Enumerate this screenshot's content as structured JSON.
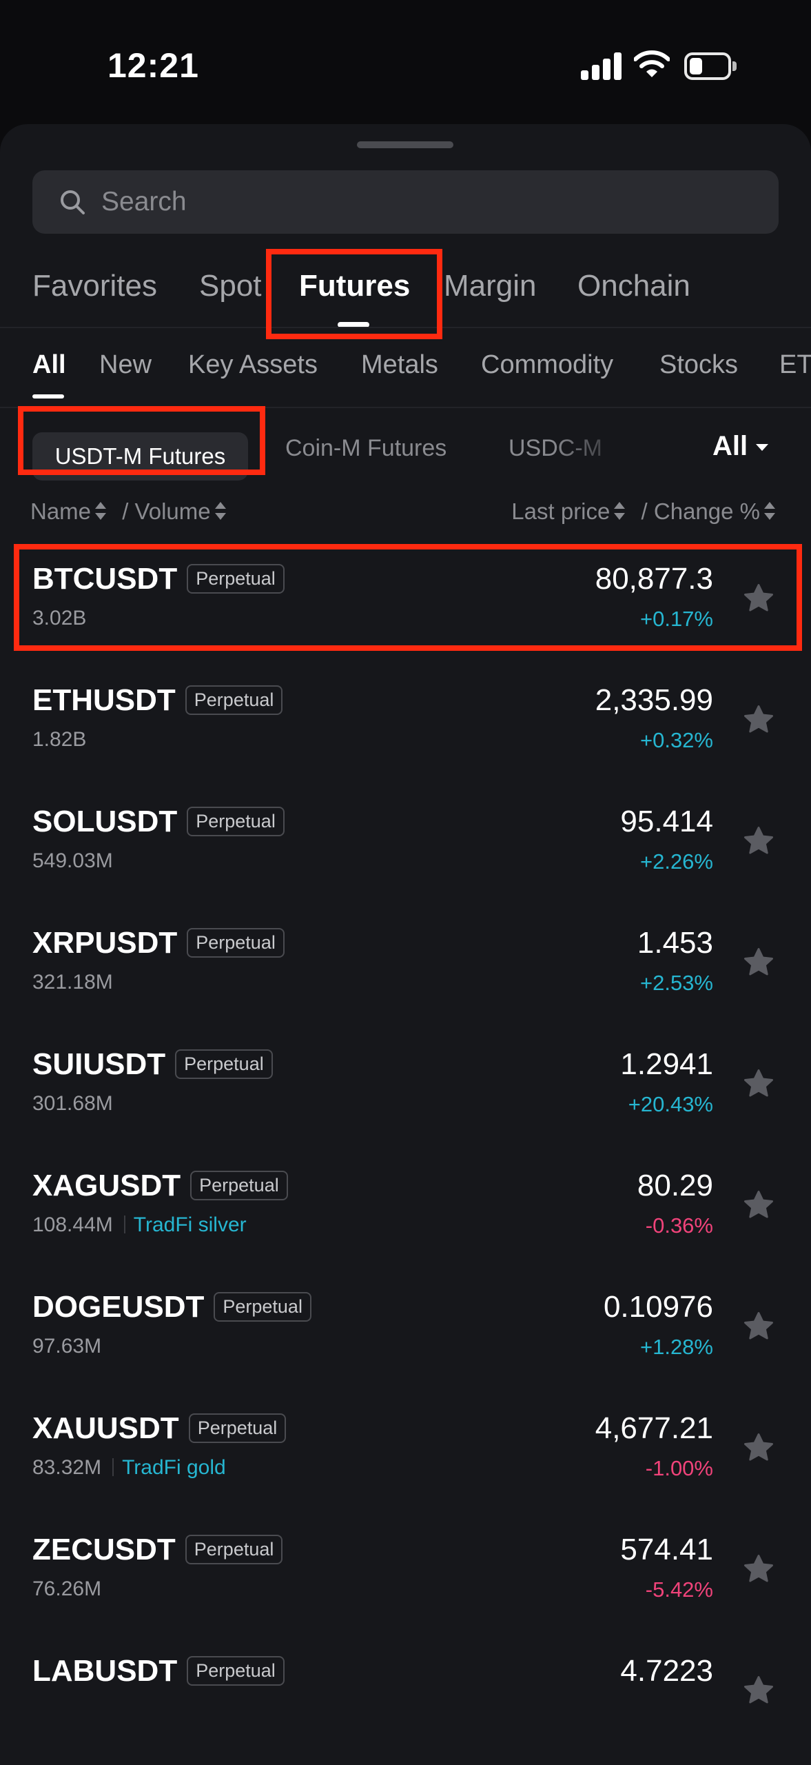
{
  "status_bar": {
    "time": "12:21"
  },
  "search": {
    "placeholder": "Search"
  },
  "main_tabs": [
    "Favorites",
    "Spot",
    "Futures",
    "Margin",
    "Onchain"
  ],
  "category_tabs": [
    "All",
    "New",
    "Key Assets",
    "Metals",
    "Commodity",
    "Stocks",
    "ET"
  ],
  "sub_tabs": [
    "USDT-M Futures",
    "Coin-M Futures",
    "USDC-M"
  ],
  "filter": {
    "label": "All"
  },
  "columns": {
    "name": "Name",
    "volume": "/ Volume",
    "last_price": "Last price",
    "change": "/ Change %"
  },
  "colors": {
    "up": "#26b6d1",
    "down": "#f0437a",
    "highlight": "#ff2a10"
  },
  "rows": [
    {
      "symbol": "BTCUSDT",
      "badge": "Perpetual",
      "volume": "3.02B",
      "tag": "",
      "price": "80,877.3",
      "change": "+0.17%",
      "direction": "up"
    },
    {
      "symbol": "ETHUSDT",
      "badge": "Perpetual",
      "volume": "1.82B",
      "tag": "",
      "price": "2,335.99",
      "change": "+0.32%",
      "direction": "up"
    },
    {
      "symbol": "SOLUSDT",
      "badge": "Perpetual",
      "volume": "549.03M",
      "tag": "",
      "price": "95.414",
      "change": "+2.26%",
      "direction": "up"
    },
    {
      "symbol": "XRPUSDT",
      "badge": "Perpetual",
      "volume": "321.18M",
      "tag": "",
      "price": "1.453",
      "change": "+2.53%",
      "direction": "up"
    },
    {
      "symbol": "SUIUSDT",
      "badge": "Perpetual",
      "volume": "301.68M",
      "tag": "",
      "price": "1.2941",
      "change": "+20.43%",
      "direction": "up"
    },
    {
      "symbol": "XAGUSDT",
      "badge": "Perpetual",
      "volume": "108.44M",
      "tag": "TradFi silver",
      "price": "80.29",
      "change": "-0.36%",
      "direction": "down"
    },
    {
      "symbol": "DOGEUSDT",
      "badge": "Perpetual",
      "volume": "97.63M",
      "tag": "",
      "price": "0.10976",
      "change": "+1.28%",
      "direction": "up"
    },
    {
      "symbol": "XAUUSDT",
      "badge": "Perpetual",
      "volume": "83.32M",
      "tag": "TradFi gold",
      "price": "4,677.21",
      "change": "-1.00%",
      "direction": "down"
    },
    {
      "symbol": "ZECUSDT",
      "badge": "Perpetual",
      "volume": "76.26M",
      "tag": "",
      "price": "574.41",
      "change": "-5.42%",
      "direction": "down"
    },
    {
      "symbol": "LABUSDT",
      "badge": "Perpetual",
      "volume": "",
      "tag": "",
      "price": "4.7223",
      "change": "",
      "direction": "up"
    }
  ]
}
